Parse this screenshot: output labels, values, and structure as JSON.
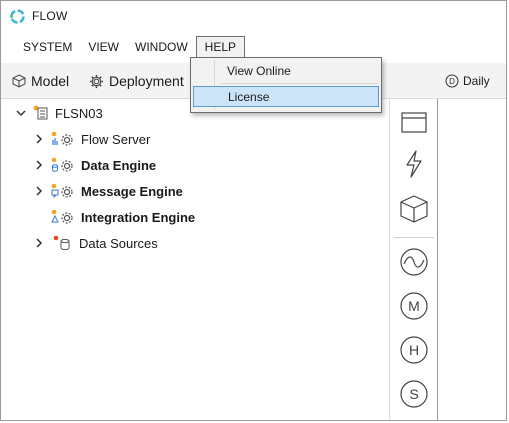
{
  "app": {
    "title": "FLOW",
    "logo_icon": "flow-ring-logo"
  },
  "menubar": {
    "items": [
      {
        "label": "SYSTEM"
      },
      {
        "label": "VIEW"
      },
      {
        "label": "WINDOW"
      },
      {
        "label": "HELP"
      }
    ],
    "active": "HELP"
  },
  "help_menu": {
    "items": [
      {
        "label": "View Online"
      },
      {
        "label": "License",
        "highlighted": true
      }
    ]
  },
  "tabs": [
    {
      "label": "Model",
      "icon": "cube-icon"
    },
    {
      "label": "Deployment",
      "icon": "gear-icon"
    }
  ],
  "toolbar": {
    "daily_label": "Daily",
    "daily_badge": "D"
  },
  "tree": {
    "root": {
      "label": "FLSN03",
      "icon": "server-icon",
      "status_color": "#f5a623"
    },
    "children": [
      {
        "label": "Flow Server",
        "bold": false,
        "expandable": true
      },
      {
        "label": "Data Engine",
        "bold": true,
        "expandable": true
      },
      {
        "label": "Message Engine",
        "bold": true,
        "expandable": true
      },
      {
        "label": "Integration Engine",
        "bold": true,
        "expandable": false
      },
      {
        "label": "Data Sources",
        "bold": false,
        "expandable": true,
        "icon": "database-icon",
        "status_color": "#e8491d"
      }
    ]
  },
  "tools": [
    {
      "name": "window-icon"
    },
    {
      "name": "lightning-icon"
    },
    {
      "name": "cube-outline-icon"
    },
    {
      "name": "wave-icon"
    },
    {
      "name": "circle-m-icon",
      "letter": "M"
    },
    {
      "name": "circle-h-icon",
      "letter": "H"
    },
    {
      "name": "circle-s-icon",
      "letter": "S"
    }
  ],
  "colors": {
    "accent_blue": "#5e9ad6",
    "highlight": "#cce4f7",
    "status_orange": "#f5a623",
    "status_red": "#e8491d"
  }
}
